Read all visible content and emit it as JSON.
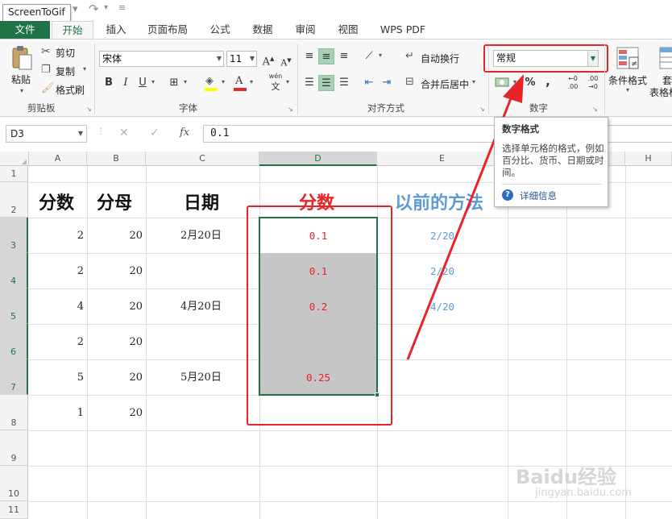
{
  "quick_access": {
    "capture_label": "ScreenToGif"
  },
  "tabs": [
    {
      "label": "文件"
    },
    {
      "label": "开始"
    },
    {
      "label": "插入"
    },
    {
      "label": "页面布局"
    },
    {
      "label": "公式"
    },
    {
      "label": "数据"
    },
    {
      "label": "审阅"
    },
    {
      "label": "视图"
    },
    {
      "label": "WPS PDF"
    }
  ],
  "ribbon": {
    "clipboard": {
      "paste": "粘贴",
      "cut": "剪切",
      "copy": "复制",
      "format_painter": "格式刷",
      "group": "剪贴板"
    },
    "font": {
      "name": "宋体",
      "size": "11",
      "bold": "B",
      "italic": "I",
      "underline": "U",
      "grow": "A",
      "shrink": "A",
      "phonetic": "wén",
      "phonetic_sub": "文",
      "group": "字体"
    },
    "alignment": {
      "wrap_text": "自动换行",
      "merge_center": "合并后居中",
      "group": "对齐方式"
    },
    "number": {
      "format_value": "常规",
      "percent": "%",
      "comma": ",",
      "inc_decimal_top": "←0",
      "inc_decimal_bottom": ".00",
      "dec_decimal_top": ".00",
      "dec_decimal_bottom": "→0",
      "group": "数字"
    },
    "styles": {
      "conditional_format": "条件格式",
      "table_format_top": "套",
      "table_format_bottom": "表格格"
    }
  },
  "tooltip": {
    "title": "数字格式",
    "body": "选择单元格的格式，例如百分比、货币、日期或时间。",
    "more_info": "详细信息"
  },
  "formula_bar": {
    "name_box": "D3",
    "cancel": "✕",
    "enter": "✓",
    "fx": "fx",
    "value": "0.1"
  },
  "sheet": {
    "columns": [
      "A",
      "B",
      "C",
      "D",
      "E",
      "F",
      "G",
      "H"
    ],
    "rows": [
      "1",
      "2",
      "3",
      "4",
      "5",
      "6",
      "7",
      "8",
      "9",
      "10",
      "11"
    ],
    "header_row": {
      "a": "分数",
      "b": "分母",
      "c": "日期",
      "d": "分数",
      "e": "以前的方法"
    },
    "data": [
      {
        "a": "2",
        "b": "20",
        "c": "2月20日",
        "d": "0.1",
        "e": "2/20"
      },
      {
        "a": "2",
        "b": "20",
        "c": "",
        "d": "0.1",
        "e": "2/20"
      },
      {
        "a": "4",
        "b": "20",
        "c": "4月20日",
        "d": "0.2",
        "e": "4/20"
      },
      {
        "a": "2",
        "b": "20",
        "c": "",
        "d": "",
        "e": ""
      },
      {
        "a": "5",
        "b": "20",
        "c": "5月20日",
        "d": "0.25",
        "e": ""
      },
      {
        "a": "1",
        "b": "20",
        "c": "",
        "d": "",
        "e": ""
      }
    ]
  },
  "watermark": {
    "brand": "Baidu经验",
    "url": "jingyan.baidu.com"
  },
  "colors": {
    "excel_green": "#217346",
    "annotation_red": "#e8232a",
    "fraction_blue": "#5b9bd5",
    "header_red": "#e8232a",
    "selection_gray": "#c6c6c6"
  }
}
